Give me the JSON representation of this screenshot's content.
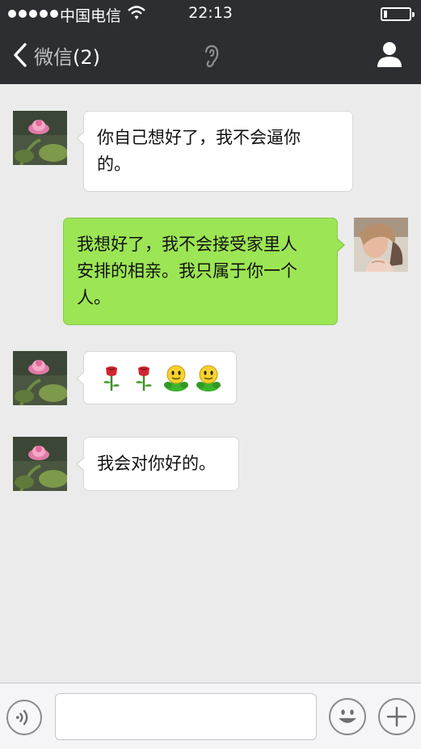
{
  "status_bar": {
    "carrier": "中国电信",
    "time": "22:13",
    "signal_icon": "signal-dots-icon",
    "wifi_icon": "wifi-icon",
    "battery_icon": "battery-icon"
  },
  "nav": {
    "back_label": "微信",
    "unread_count": "(2)",
    "back_icon": "chevron-left-icon",
    "ear_icon": "ear-icon",
    "profile_icon": "person-icon"
  },
  "messages": [
    {
      "side": "left",
      "sender": "contact",
      "text_line1": "你自己想好了，我不会逼你",
      "text_line2": "的。"
    },
    {
      "side": "right",
      "sender": "me",
      "text_line1": "我想好了，我不会接受家里人",
      "text_line2": "安排的相亲。我只属于你一个",
      "text_line3": "人。"
    },
    {
      "side": "left",
      "sender": "contact",
      "emojis": [
        "rose-icon",
        "rose-icon",
        "smiley-figure-icon",
        "smiley-figure-icon"
      ]
    },
    {
      "side": "left",
      "sender": "contact",
      "text": "我会对你好的。"
    }
  ],
  "input_bar": {
    "voice_icon": "voice-icon",
    "text_value": "",
    "emoji_icon": "smiley-icon",
    "more_icon": "plus-icon"
  },
  "colors": {
    "nav_bg": "#2d2e32",
    "chat_bg": "#ebebeb",
    "my_bubble": "#9ce554",
    "their_bubble": "#ffffff"
  }
}
